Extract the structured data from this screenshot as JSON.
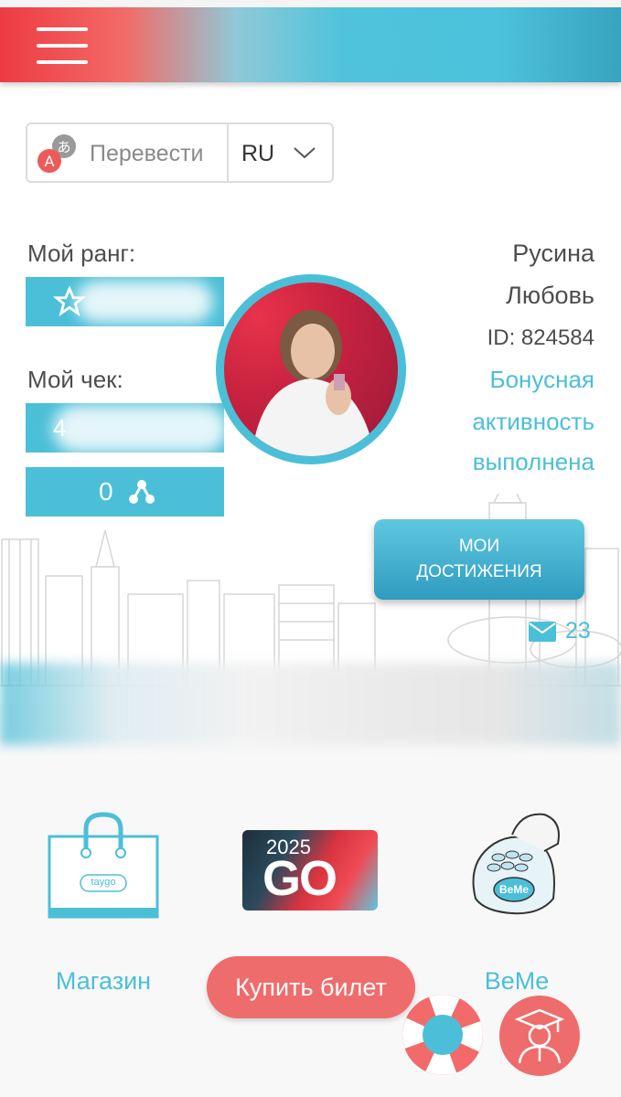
{
  "header": {
    "menu_icon": "hamburger-menu-icon"
  },
  "translate": {
    "label": "Перевести",
    "language": "RU",
    "icon": "translate-icon"
  },
  "profile": {
    "rank_label": "Мой ранг:",
    "check_label": "Мой чек:",
    "check_value_prefix": "4",
    "network_count": "0",
    "surname": "Русина",
    "name": "Любовь",
    "id_text": "ID: 824584",
    "bonus_line1": "Бонусная",
    "bonus_line2": "активность",
    "bonus_line3": "выполнена"
  },
  "achievements": {
    "line1": "МОИ",
    "line2": "ДОСТИЖЕНИЯ"
  },
  "messages": {
    "count": "23"
  },
  "tiles": {
    "shop_label": "Магазин",
    "shop_bag_text": "taygo",
    "go_year": "2025",
    "go_text": "GO",
    "beme_label": "BeMe",
    "beme_device_text": "BeMe"
  },
  "buy_ticket": {
    "label": "Купить билет"
  },
  "colors": {
    "accent": "#4bbfd8",
    "coral": "#ef6c6c",
    "red": "#ee3b43"
  }
}
